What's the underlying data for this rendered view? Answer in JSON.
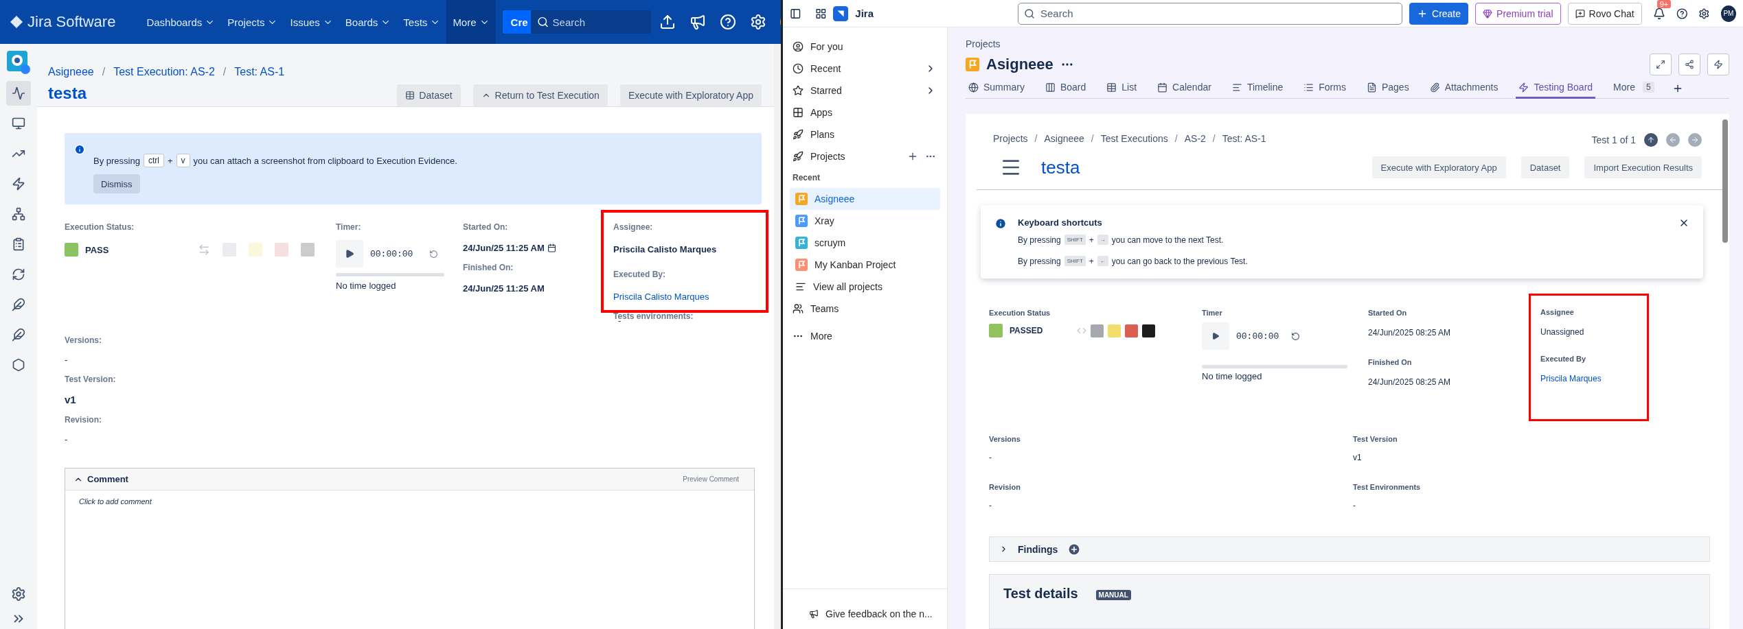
{
  "left": {
    "nav": {
      "product": "Jira Software",
      "menus": [
        {
          "label": "Dashboards",
          "selected": false
        },
        {
          "label": "Projects",
          "selected": false
        },
        {
          "label": "Issues",
          "selected": false
        },
        {
          "label": "Boards",
          "selected": false
        },
        {
          "label": "Tests",
          "selected": false
        },
        {
          "label": "More",
          "selected": true
        }
      ],
      "create": "Cre",
      "search_placeholder": "Search"
    },
    "rail": [
      {
        "selected": true
      },
      {
        "selected": false
      },
      {
        "selected": false
      },
      {
        "selected": false
      },
      {
        "selected": false
      },
      {
        "selected": false
      },
      {
        "selected": false
      },
      {
        "selected": false
      },
      {
        "selected": false
      },
      {
        "selected": false
      }
    ],
    "breadcrumb_separator": "/",
    "breadcrumbs": [
      "Asigneee",
      "Test Execution: AS-2",
      "Test: AS-1"
    ],
    "title": "testa",
    "buttons": [
      {
        "label": "Dataset",
        "kind": "table"
      },
      {
        "label": "Return to Test Execution",
        "kind": "up"
      },
      {
        "label": "Execute with Exploratory App",
        "kind": "plain"
      }
    ],
    "notice": {
      "before": "By pressing",
      "keys": [
        "ctrl",
        "v"
      ],
      "plus": "+",
      "after": "you can attach a screenshot from clipboard to Execution Evidence.",
      "button": "Dismiss"
    },
    "status": {
      "label": "Execution Status:",
      "value": "PASS",
      "color": "#8bc262",
      "swatches": [
        {
          "color": "#ebecf0"
        },
        {
          "color": "#fbf7dc"
        },
        {
          "color": "#f6dfdf"
        },
        {
          "color": "#cccccc"
        }
      ]
    },
    "timer": {
      "label": "Timer:",
      "time": "00:00:00",
      "logged": "No time logged",
      "level": 0
    },
    "started": {
      "label": "Started On:",
      "value": "24/Jun/25 11:25 AM"
    },
    "finished": {
      "label": "Finished On:",
      "value": "24/Jun/25 11:25 AM"
    },
    "people": {
      "highlighted": true,
      "assignee_label": "Assignee:",
      "assignee": "Priscila Calisto Marques",
      "executed_label": "Executed By:",
      "executed": "Priscila Calisto Marques",
      "env_label": "Tests environments:",
      "env": "-"
    },
    "fields": [
      {
        "label": "Versions:",
        "value": "-",
        "bold": false
      },
      {
        "label": "Test Version:",
        "value": "v1",
        "bold": true
      },
      {
        "label": "Revision:",
        "value": "-",
        "bold": false
      }
    ],
    "comment": {
      "title": "Comment",
      "preview": "Preview Comment",
      "placeholder": "Click to add comment",
      "expanded": true
    }
  },
  "right": {
    "topbar": {
      "product": "Jira",
      "search_placeholder": "Search",
      "create": "Create",
      "premium": "Premium trial",
      "rovo": "Rovo Chat",
      "notifications": "9+",
      "avatar": "PM"
    },
    "sidebar": {
      "items": [
        {
          "label": "For you",
          "kind": "user",
          "expandable": false
        },
        {
          "label": "Recent",
          "kind": "clock",
          "expandable": true
        },
        {
          "label": "Starred",
          "kind": "star",
          "expandable": true
        },
        {
          "label": "Apps",
          "kind": "apps",
          "expandable": false
        },
        {
          "label": "Plans",
          "kind": "plans",
          "expandable": false
        }
      ],
      "projects_label": "Projects",
      "recent_label": "Recent",
      "projects": [
        {
          "label": "Asigneee",
          "color": "#f5a623",
          "selected": true
        },
        {
          "label": "Xray",
          "color": "#4c9aff",
          "selected": false
        },
        {
          "label": "scruym",
          "color": "#36b3d6",
          "selected": false
        },
        {
          "label": "My Kanban Project",
          "color": "#ff8f73",
          "selected": false
        }
      ],
      "view_all": "View all projects",
      "teams": "Teams",
      "more": "More",
      "feedback": "Give feedback on the n..."
    },
    "header": {
      "crumb": "Projects",
      "title": "Asigneee",
      "tabs": [
        {
          "label": "Summary",
          "kind": "globe",
          "selected": false
        },
        {
          "label": "Board",
          "kind": "board",
          "selected": false
        },
        {
          "label": "List",
          "kind": "list",
          "selected": false
        },
        {
          "label": "Calendar",
          "kind": "calendar",
          "selected": false
        },
        {
          "label": "Timeline",
          "kind": "timeline",
          "selected": false
        },
        {
          "label": "Forms",
          "kind": "forms",
          "selected": false
        },
        {
          "label": "Pages",
          "kind": "pages",
          "selected": false
        },
        {
          "label": "Attachments",
          "kind": "attachments",
          "selected": false
        },
        {
          "label": "Testing Board",
          "kind": "bolt",
          "selected": true
        }
      ],
      "more": "More",
      "more_count": "5"
    },
    "card": {
      "breadcrumb_separator": "/",
      "breadcrumbs": [
        "Projects",
        "Asigneee",
        "Test Executions",
        "AS-2",
        "Test: AS-1"
      ],
      "pager": "Test 1 of 1",
      "title": "testa",
      "buttons": [
        "Execute with Exploratory App",
        "Dataset",
        "Import Execution Results"
      ]
    },
    "shortcuts": {
      "title": "Keyboard shortcuts",
      "lines": [
        {
          "before": "By pressing",
          "key": "SHIFT",
          "plus": "+",
          "arrow": "→",
          "after": "you can move to the next Test."
        },
        {
          "before": "By pressing",
          "key": "SHIFT",
          "plus": "+",
          "arrow": "←",
          "after": "you can go back to the previous Test."
        }
      ]
    },
    "status": {
      "label": "Execution Status",
      "value": "PASSED",
      "color": "#94c160",
      "swatches": [
        {
          "color": "#a5a8ad"
        },
        {
          "color": "#f1de6b"
        },
        {
          "color": "#d9604f"
        },
        {
          "color": "#1d1d1d"
        }
      ]
    },
    "timer": {
      "label": "Timer",
      "time": "00:00:00",
      "logged": "No time logged",
      "level": 0
    },
    "started": {
      "label": "Started On",
      "value": "24/Jun/2025 08:25 AM"
    },
    "finished": {
      "label": "Finished On",
      "value": "24/Jun/2025 08:25 AM"
    },
    "people": {
      "highlighted": true,
      "assignee_label": "Assignee",
      "assignee": "Unassigned",
      "executed_label": "Executed By",
      "executed": "Priscila Marques"
    },
    "fields": [
      {
        "label": "Versions",
        "value": "-"
      },
      {
        "label": "Test Version",
        "value": "v1"
      },
      {
        "label": "Revision",
        "value": "-"
      },
      {
        "label": "Test Environments",
        "value": "-"
      }
    ],
    "findings": {
      "title": "Findings",
      "expanded": false
    },
    "details": {
      "title": "Test details",
      "badge": "MANUAL"
    }
  }
}
